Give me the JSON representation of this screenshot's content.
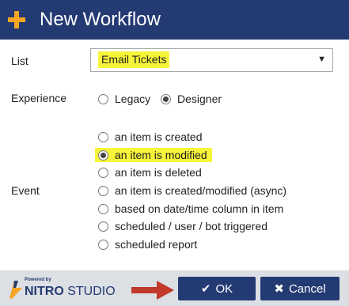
{
  "dialog": {
    "title": "New Workflow",
    "header_color": "#243a73"
  },
  "form": {
    "list": {
      "label": "List",
      "selected": "Email Tickets"
    },
    "experience": {
      "label": "Experience",
      "options": [
        {
          "label": "Legacy",
          "checked": false
        },
        {
          "label": "Designer",
          "checked": true
        }
      ]
    },
    "event": {
      "label": "Event",
      "options": [
        {
          "label": "an item is created",
          "checked": false
        },
        {
          "label": "an item is modified",
          "checked": true
        },
        {
          "label": "an item is deleted",
          "checked": false
        },
        {
          "label": "an item is created/modified (async)",
          "checked": false
        },
        {
          "label": "based on date/time column in item",
          "checked": false
        },
        {
          "label": "scheduled / user / bot triggered",
          "checked": false
        },
        {
          "label": "scheduled report",
          "checked": false
        }
      ]
    }
  },
  "footer": {
    "powered_by": "Powered by",
    "brand_bold": "NITRO",
    "brand_regular": "STUDIO",
    "ok_label": "OK",
    "cancel_label": "Cancel"
  },
  "highlight_color": "#f7f53a",
  "arrow_color": "#c0392b",
  "icons": [
    "plus-icon",
    "dropdown-arrow-icon",
    "bolt-icon",
    "arrow-icon",
    "checkmark-icon",
    "close-icon"
  ]
}
